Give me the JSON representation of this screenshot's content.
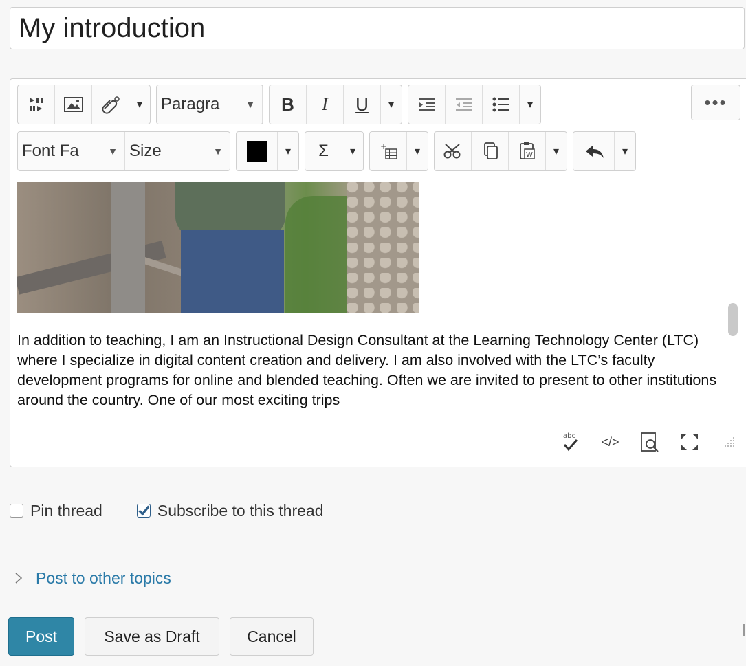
{
  "title_field": {
    "value": "My introduction"
  },
  "toolbar": {
    "row1": {
      "media_icon": "media-player-icon",
      "image_icon": "insert-image-icon",
      "attachment_icon": "attachment-icon",
      "format_select": "Paragra",
      "bold": "B",
      "italic": "I",
      "underline": "U",
      "indent_icon": "indent-icon",
      "outdent_icon": "outdent-icon",
      "list_icon": "bulleted-list-icon",
      "more": "•••"
    },
    "row2": {
      "font_family_select": "Font Fa",
      "size_select": "Size",
      "color_value": "#000000",
      "equation": "Σ",
      "table_icon": "insert-table-icon",
      "cut_icon": "cut-icon",
      "copy_icon": "copy-icon",
      "paste_icon": "paste-word-icon",
      "undo_icon": "undo-icon"
    }
  },
  "content": {
    "image_alt": "photo",
    "paragraph": "In addition to teaching, I am an Instructional Design Consultant at the Learning Technology Center (LTC) where I specialize in digital content creation and delivery.  I am also involved with the LTC’s faculty development programs for online and blended teaching.  Often we are invited to present to other institutions around the country.  One of our most exciting trips"
  },
  "statusbar": {
    "spellcheck_label": "abc",
    "source_label": "</>"
  },
  "options": {
    "pin_thread": {
      "label": "Pin thread",
      "checked": false
    },
    "subscribe": {
      "label": "Subscribe to this thread",
      "checked": true
    }
  },
  "post_other_topics": "Post to other topics",
  "buttons": {
    "post": "Post",
    "save_draft": "Save as Draft",
    "cancel": "Cancel"
  }
}
